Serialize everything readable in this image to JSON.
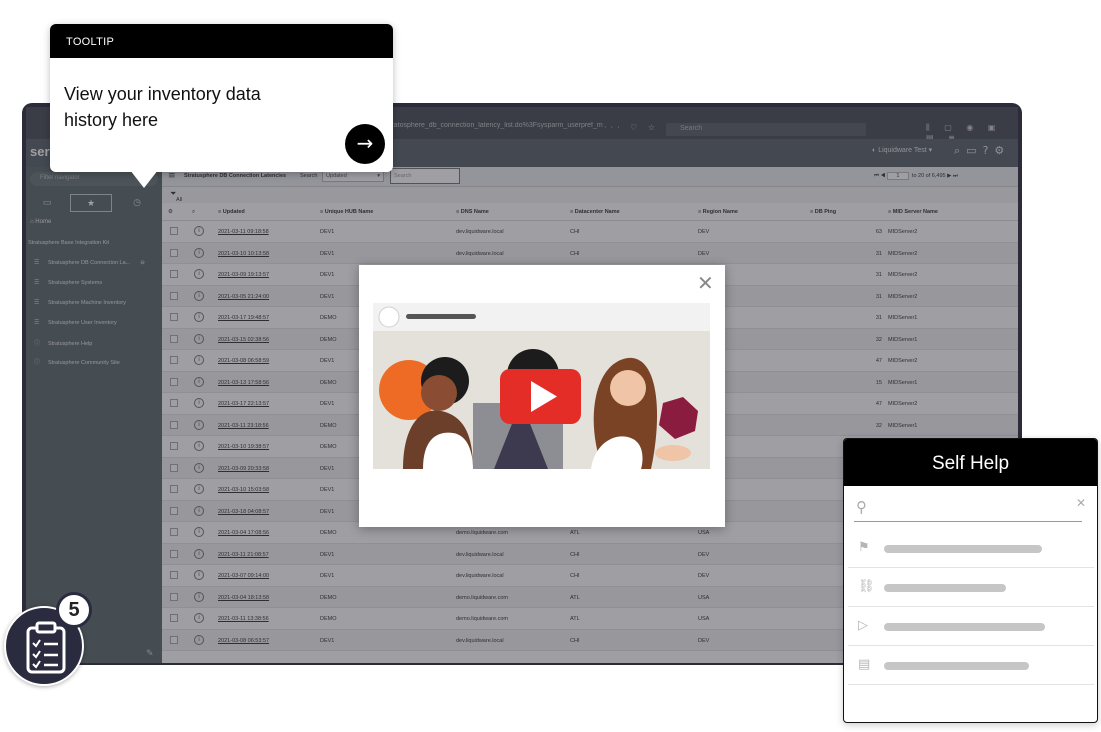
{
  "tooltip": {
    "header": "TOOLTIP",
    "body": "View your inventory data history here",
    "next_icon": "arrow-right-icon"
  },
  "browser": {
    "tab_label": "Strat",
    "url": "stratosphere_db_connection_latency_list.do%3Fsysparm_userpref_m",
    "search_placeholder": "Search"
  },
  "app": {
    "logo": "serv",
    "user": "Liquidware Test"
  },
  "nav": {
    "filter_placeholder": "Filter navigator",
    "home": "Home",
    "section": "Stratusphere Base Integration Kit",
    "items": [
      {
        "label": "Stratusphere DB Connection La..."
      },
      {
        "label": "Stratusphere Systems"
      },
      {
        "label": "Stratusphere Machine Inventory"
      },
      {
        "label": "Stratusphere User Inventory"
      },
      {
        "label": "Stratusphere Help"
      },
      {
        "label": "Stratusphere Community Site"
      }
    ]
  },
  "list": {
    "title": "Stratusphere DB Connection Latencies",
    "search_label": "Search",
    "search_field": "Updated",
    "search_placeholder": "Search",
    "page_value": "1",
    "page_range": "to 20 of 6,495",
    "filter": "All",
    "columns": [
      "Updated",
      "Unique HUB Name",
      "DNS Name",
      "Datacenter Name",
      "Region Name",
      "DB Ping",
      "MID Server Name"
    ],
    "rows": [
      {
        "updated": "2021-03-11 09:18:58",
        "hub": "DEV1",
        "dns": "dev.liquidware.local",
        "dc": "CHI",
        "region": "DEV",
        "ping": "63",
        "mid": "MIDServer2"
      },
      {
        "updated": "2021-03-10 10:13:58",
        "hub": "DEV1",
        "dns": "dev.liquidware.local",
        "dc": "CHI",
        "region": "DEV",
        "ping": "31",
        "mid": "MIDServer2"
      },
      {
        "updated": "2021-03-09 19:13:57",
        "hub": "DEV1",
        "dns": "",
        "dc": "",
        "region": "",
        "ping": "31",
        "mid": "MIDServer2"
      },
      {
        "updated": "2021-03-05 21:24:00",
        "hub": "DEV1",
        "dns": "",
        "dc": "",
        "region": "",
        "ping": "31",
        "mid": "MIDServer2"
      },
      {
        "updated": "2021-03-17 19:48:57",
        "hub": "DEMO",
        "dns": "",
        "dc": "",
        "region": "",
        "ping": "31",
        "mid": "MIDServer1"
      },
      {
        "updated": "2021-03-15 02:38:56",
        "hub": "DEMO",
        "dns": "",
        "dc": "",
        "region": "",
        "ping": "32",
        "mid": "MIDServer1"
      },
      {
        "updated": "2021-03-08 06:58:59",
        "hub": "DEV1",
        "dns": "",
        "dc": "",
        "region": "",
        "ping": "47",
        "mid": "MIDServer2"
      },
      {
        "updated": "2021-03-13 17:58:56",
        "hub": "DEMO",
        "dns": "",
        "dc": "",
        "region": "",
        "ping": "15",
        "mid": "MIDServer1"
      },
      {
        "updated": "2021-03-17 22:13:57",
        "hub": "DEV1",
        "dns": "",
        "dc": "",
        "region": "",
        "ping": "47",
        "mid": "MIDServer2"
      },
      {
        "updated": "2021-03-11 23:18:56",
        "hub": "DEMO",
        "dns": "",
        "dc": "",
        "region": "",
        "ping": "32",
        "mid": "MIDServer1"
      },
      {
        "updated": "2021-03-10 19:38:57",
        "hub": "DEMO",
        "dns": "",
        "dc": "",
        "region": "",
        "ping": "",
        "mid": ""
      },
      {
        "updated": "2021-03-09 20:33:58",
        "hub": "DEV1",
        "dns": "",
        "dc": "",
        "region": "",
        "ping": "",
        "mid": ""
      },
      {
        "updated": "2021-03-10 15:03:58",
        "hub": "DEV1",
        "dns": "",
        "dc": "",
        "region": "",
        "ping": "",
        "mid": ""
      },
      {
        "updated": "2021-03-18 04:08:57",
        "hub": "DEV1",
        "dns": "",
        "dc": "",
        "region": "",
        "ping": "",
        "mid": ""
      },
      {
        "updated": "2021-03-04 17:08:56",
        "hub": "DEMO",
        "dns": "demo.liquidware.com",
        "dc": "ATL",
        "region": "USA",
        "ping": "",
        "mid": ""
      },
      {
        "updated": "2021-03-11 21:08:57",
        "hub": "DEV1",
        "dns": "dev.liquidware.local",
        "dc": "CHI",
        "region": "DEV",
        "ping": "",
        "mid": ""
      },
      {
        "updated": "2021-03-07 09:14:00",
        "hub": "DEV1",
        "dns": "dev.liquidware.local",
        "dc": "CHI",
        "region": "DEV",
        "ping": "",
        "mid": ""
      },
      {
        "updated": "2021-03-04 18:13:58",
        "hub": "DEMO",
        "dns": "demo.liquidware.com",
        "dc": "ATL",
        "region": "USA",
        "ping": "",
        "mid": ""
      },
      {
        "updated": "2021-03-11 13:38:56",
        "hub": "DEMO",
        "dns": "demo.liquidware.com",
        "dc": "ATL",
        "region": "USA",
        "ping": "",
        "mid": ""
      },
      {
        "updated": "2021-03-08 06:53:57",
        "hub": "DEV1",
        "dns": "dev.liquidware.local",
        "dc": "CHI",
        "region": "DEV",
        "ping": "",
        "mid": ""
      }
    ]
  },
  "video_modal": {
    "close_icon": "close-icon",
    "play_icon": "play-icon",
    "colors": {
      "play_red": "#e52d27",
      "orange": "#ee6b26",
      "maroon": "#8a1c3f"
    }
  },
  "self_help": {
    "title": "Self Help",
    "items": [
      {
        "icon": "signpost-icon",
        "fill": 0.62
      },
      {
        "icon": "link-icon",
        "fill": 0.48
      },
      {
        "icon": "play-circle-icon",
        "fill": 0.63
      },
      {
        "icon": "document-icon",
        "fill": 0.57
      }
    ]
  },
  "checklist": {
    "count": "5",
    "icon": "clipboard-checklist-icon"
  }
}
